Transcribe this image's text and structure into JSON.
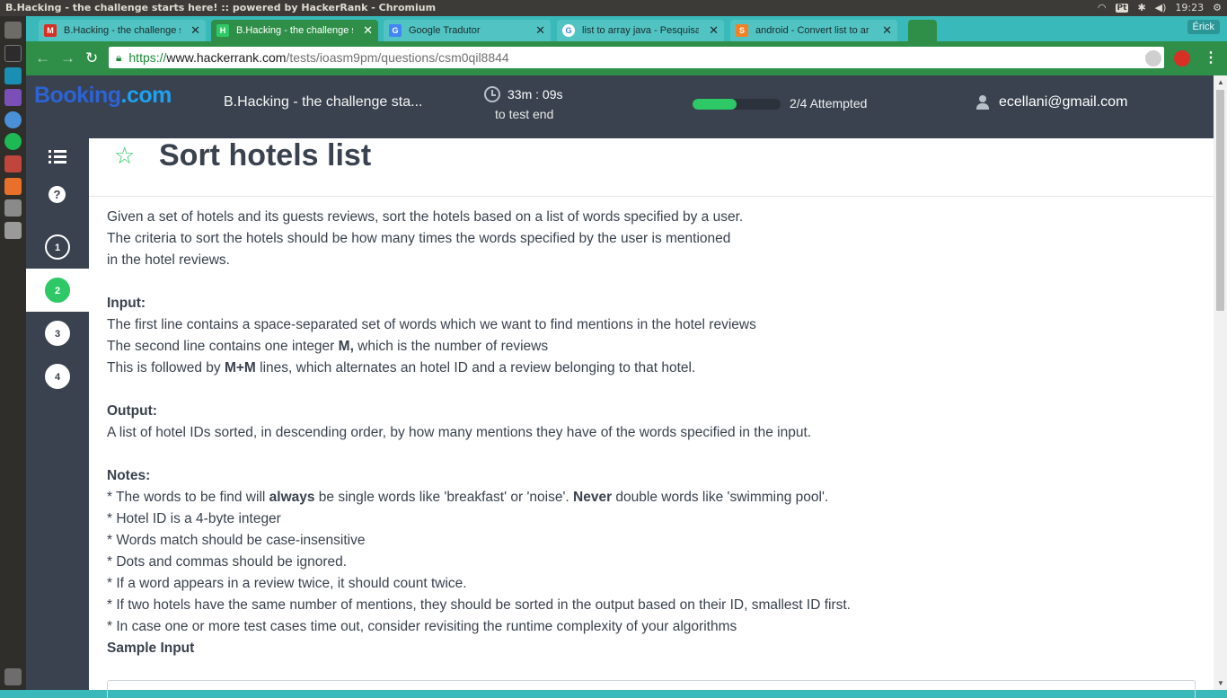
{
  "os": {
    "window_title": "B.Hacking - the challenge starts here! :: powered by HackerRank - Chromium",
    "keyboard_layout": "Pt",
    "clock": "19:23"
  },
  "browser": {
    "tabs": [
      {
        "label": "B.Hacking - the challenge s",
        "favicon": "gmail-icon",
        "favicon_color": "#d93025"
      },
      {
        "label": "B.Hacking - the challenge s",
        "favicon": "hackerrank-icon",
        "favicon_color": "#2ec866"
      },
      {
        "label": "Google Tradutor",
        "favicon": "google-translate-icon",
        "favicon_color": "#4285f4"
      },
      {
        "label": "list to array java - Pesquisa",
        "favicon": "google-icon",
        "favicon_color": "#ffffff"
      },
      {
        "label": "android - Convert list to ar",
        "favicon": "stackoverflow-icon",
        "favicon_color": "#f48024"
      }
    ],
    "active_tab_index": 1,
    "profile_name": "Érick",
    "url": {
      "scheme": "https://",
      "host": "www.hackerrank.com",
      "path": "/tests/ioasm9pm/questions/csm0qil8844"
    },
    "extension_badge": "1"
  },
  "header": {
    "logo_part1": "Booking",
    "logo_part2": ".com",
    "test_title": "B.Hacking - the challenge sta...",
    "timer_value": "33m : 09s",
    "timer_sub": "to test end",
    "progress_fraction": 0.5,
    "attempted_label": "2/4 Attempted",
    "user_email": "ecellani@gmail.com",
    "colors": {
      "header_bg": "#39424e",
      "accent_green": "#2ec866"
    }
  },
  "rail": {
    "questions": [
      {
        "number": "1",
        "state": "outline"
      },
      {
        "number": "2",
        "state": "done"
      },
      {
        "number": "3",
        "state": "plain"
      },
      {
        "number": "4",
        "state": "plain"
      }
    ],
    "active_index": 1
  },
  "question": {
    "title": "Sort hotels list",
    "intro_1": "Given a set of hotels and its guests reviews, sort the hotels based on a list of words specified by a user.",
    "intro_2": "The criteria to sort the hotels should be how many times the words specified by the user is mentioned",
    "intro_3": "in the hotel reviews.",
    "input_heading": "Input:",
    "input_1": "The first line contains a space-separated set of words which we want to find mentions in the hotel reviews",
    "input_2_pre": "The second line contains one integer ",
    "input_2_bold": "M,",
    "input_2_post": " which is the number of reviews",
    "input_3_pre": "This is followed by ",
    "input_3_bold": "M+M",
    "input_3_post": " lines, which alternates an hotel ID and a review belonging to that hotel.",
    "output_heading": "Output:",
    "output_1": "A list of hotel IDs sorted, in descending order, by how many mentions they have of the words specified in the input.",
    "notes_heading": "Notes:",
    "note_1_pre": "* The words to be find will ",
    "note_1_bold1": "always",
    "note_1_mid": " be single words like 'breakfast' or 'noise'. ",
    "note_1_bold2": "Never",
    "note_1_post": " double words like 'swimming pool'.",
    "note_2": "* Hotel ID is a 4-byte integer",
    "note_3": "* Words match should be case-insensitive",
    "note_4": "* Dots and commas should be ignored.",
    "note_5": "* If a word appears in a review twice, it should count twice.",
    "note_6": "* If two hotels have the same number of mentions, they should be sorted in the output based on their ID, smallest ID first.",
    "note_7": "* In case one or more test cases time out, consider revisiting the runtime complexity of your algorithms",
    "sample_input_label": "Sample Input"
  }
}
